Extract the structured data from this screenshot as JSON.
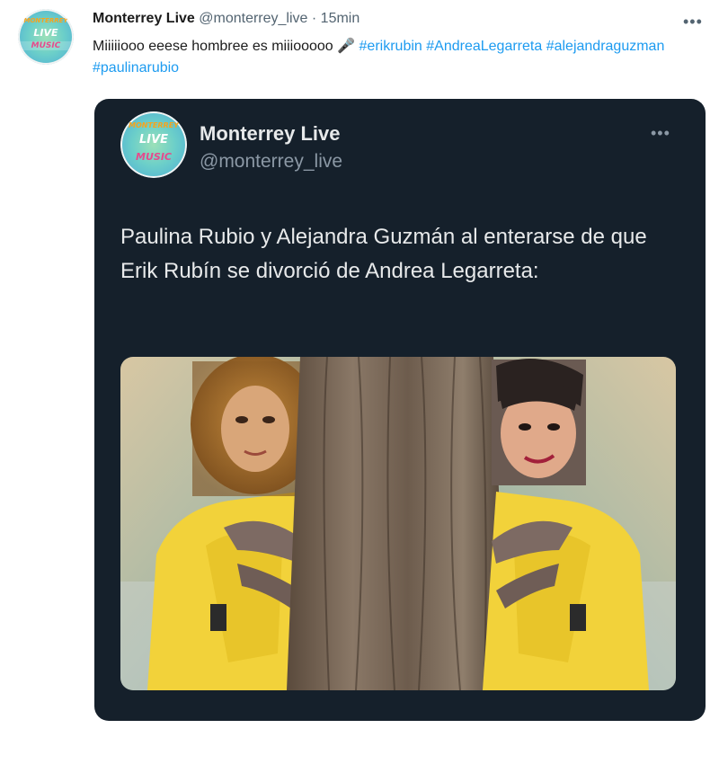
{
  "tweet": {
    "author_name": "Monterrey Live",
    "handle": "@monterrey_live",
    "separator": "·",
    "time": "15min",
    "text_main": "Miiiiiooo eeese hombree es miiiooooo",
    "text_emoji": "🎤",
    "hashtags": [
      "#erikrubin",
      "#AndreaLegarreta",
      "#alejandraguzman",
      "#paulinarubio"
    ],
    "more_icon": "more-horizontal-icon"
  },
  "avatar_logo": {
    "line1": "MONTERREY",
    "line2": "LIVE",
    "line3": "MUSIC"
  },
  "quoted": {
    "author_name": "Monterrey Live",
    "handle": "@monterrey_live",
    "text": "Paulina Rubio y Alejandra Guzmán al enterarse de que Erik Rubín se divorció de Andrea Legarreta:",
    "more_icon": "more-horizontal-icon",
    "media_description": "meme image: two figures in yellow jackets peeking from behind a tree trunk"
  },
  "colors": {
    "card_bg": "#15202b",
    "hashtag": "#1d9bf0",
    "jacket": "#f2d23a"
  }
}
